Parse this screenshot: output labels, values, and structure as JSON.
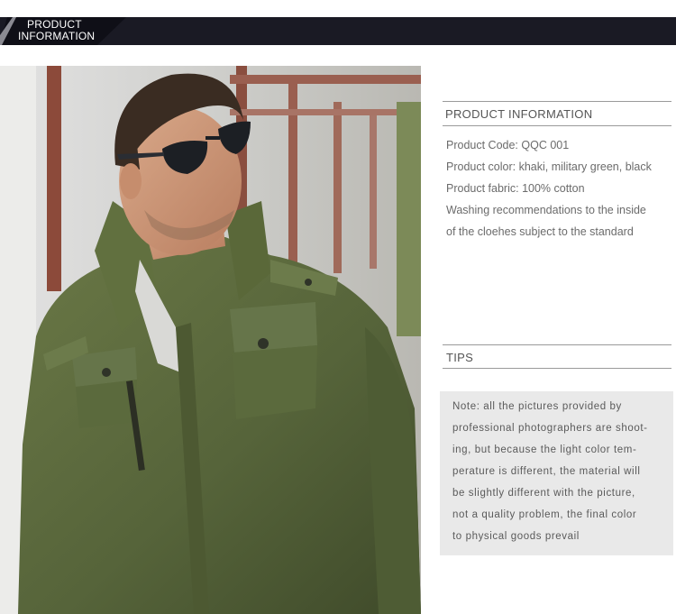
{
  "header": {
    "title_line1": "PRODUCT",
    "title_line2": "INFORMATION"
  },
  "product_info": {
    "heading": "PRODUCT INFORMATION",
    "lines": [
      "Product Code: QQC 001",
      "Product color: khaki, military green, black",
      "Product fabric: 100% cotton",
      "Washing recommendations to the inside",
      "of the cloehes subject to the standard"
    ]
  },
  "tips": {
    "heading": "TIPS",
    "note_lines": [
      "Note: all the pictures provided by",
      "professional photographers are shoot-",
      "ing, but because the light color tem-",
      "perature is different, the material will",
      "be slightly different with the picture,",
      "not a quality problem, the final color",
      "to physical goods prevail"
    ]
  },
  "colors": {
    "header_band": "#1a1a24",
    "jacket": "#5c6b3c",
    "note_box": "#e9e9e9"
  },
  "icons": {
    "photo": "model-photo"
  }
}
